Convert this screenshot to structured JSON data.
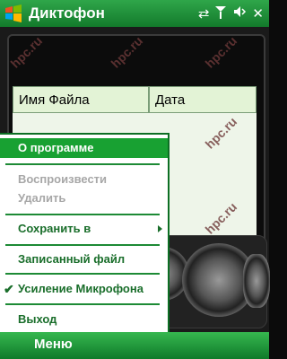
{
  "titlebar": {
    "title": "Диктофон",
    "icons": [
      "windows-start-icon",
      "connectivity-icon",
      "signal-strength-icon",
      "volume-icon",
      "close-icon"
    ],
    "close_glyph": "✕"
  },
  "list": {
    "columns": [
      {
        "label": "Имя Файла"
      },
      {
        "label": "Дата"
      }
    ]
  },
  "menu": {
    "items": [
      {
        "label": "О программе",
        "state": "selected"
      },
      {
        "label": "Воспроизвести",
        "state": "disabled"
      },
      {
        "label": "Удалить",
        "state": "disabled"
      },
      {
        "label": "Сохранить в",
        "state": "enabled",
        "submenu": true
      },
      {
        "label": "Записанный файл",
        "state": "enabled"
      },
      {
        "label": "Усиление Микрофона",
        "state": "checked"
      },
      {
        "label": "Выход",
        "state": "enabled"
      }
    ],
    "check_glyph": "✔"
  },
  "softkeys": {
    "left": "Меню"
  },
  "watermark": "hpc.ru",
  "colors": {
    "titlebar": "#1e8f3a",
    "menu_selected": "#18a132",
    "menu_text": "#1a6e2b",
    "menu_disabled": "#a7a7a7"
  }
}
